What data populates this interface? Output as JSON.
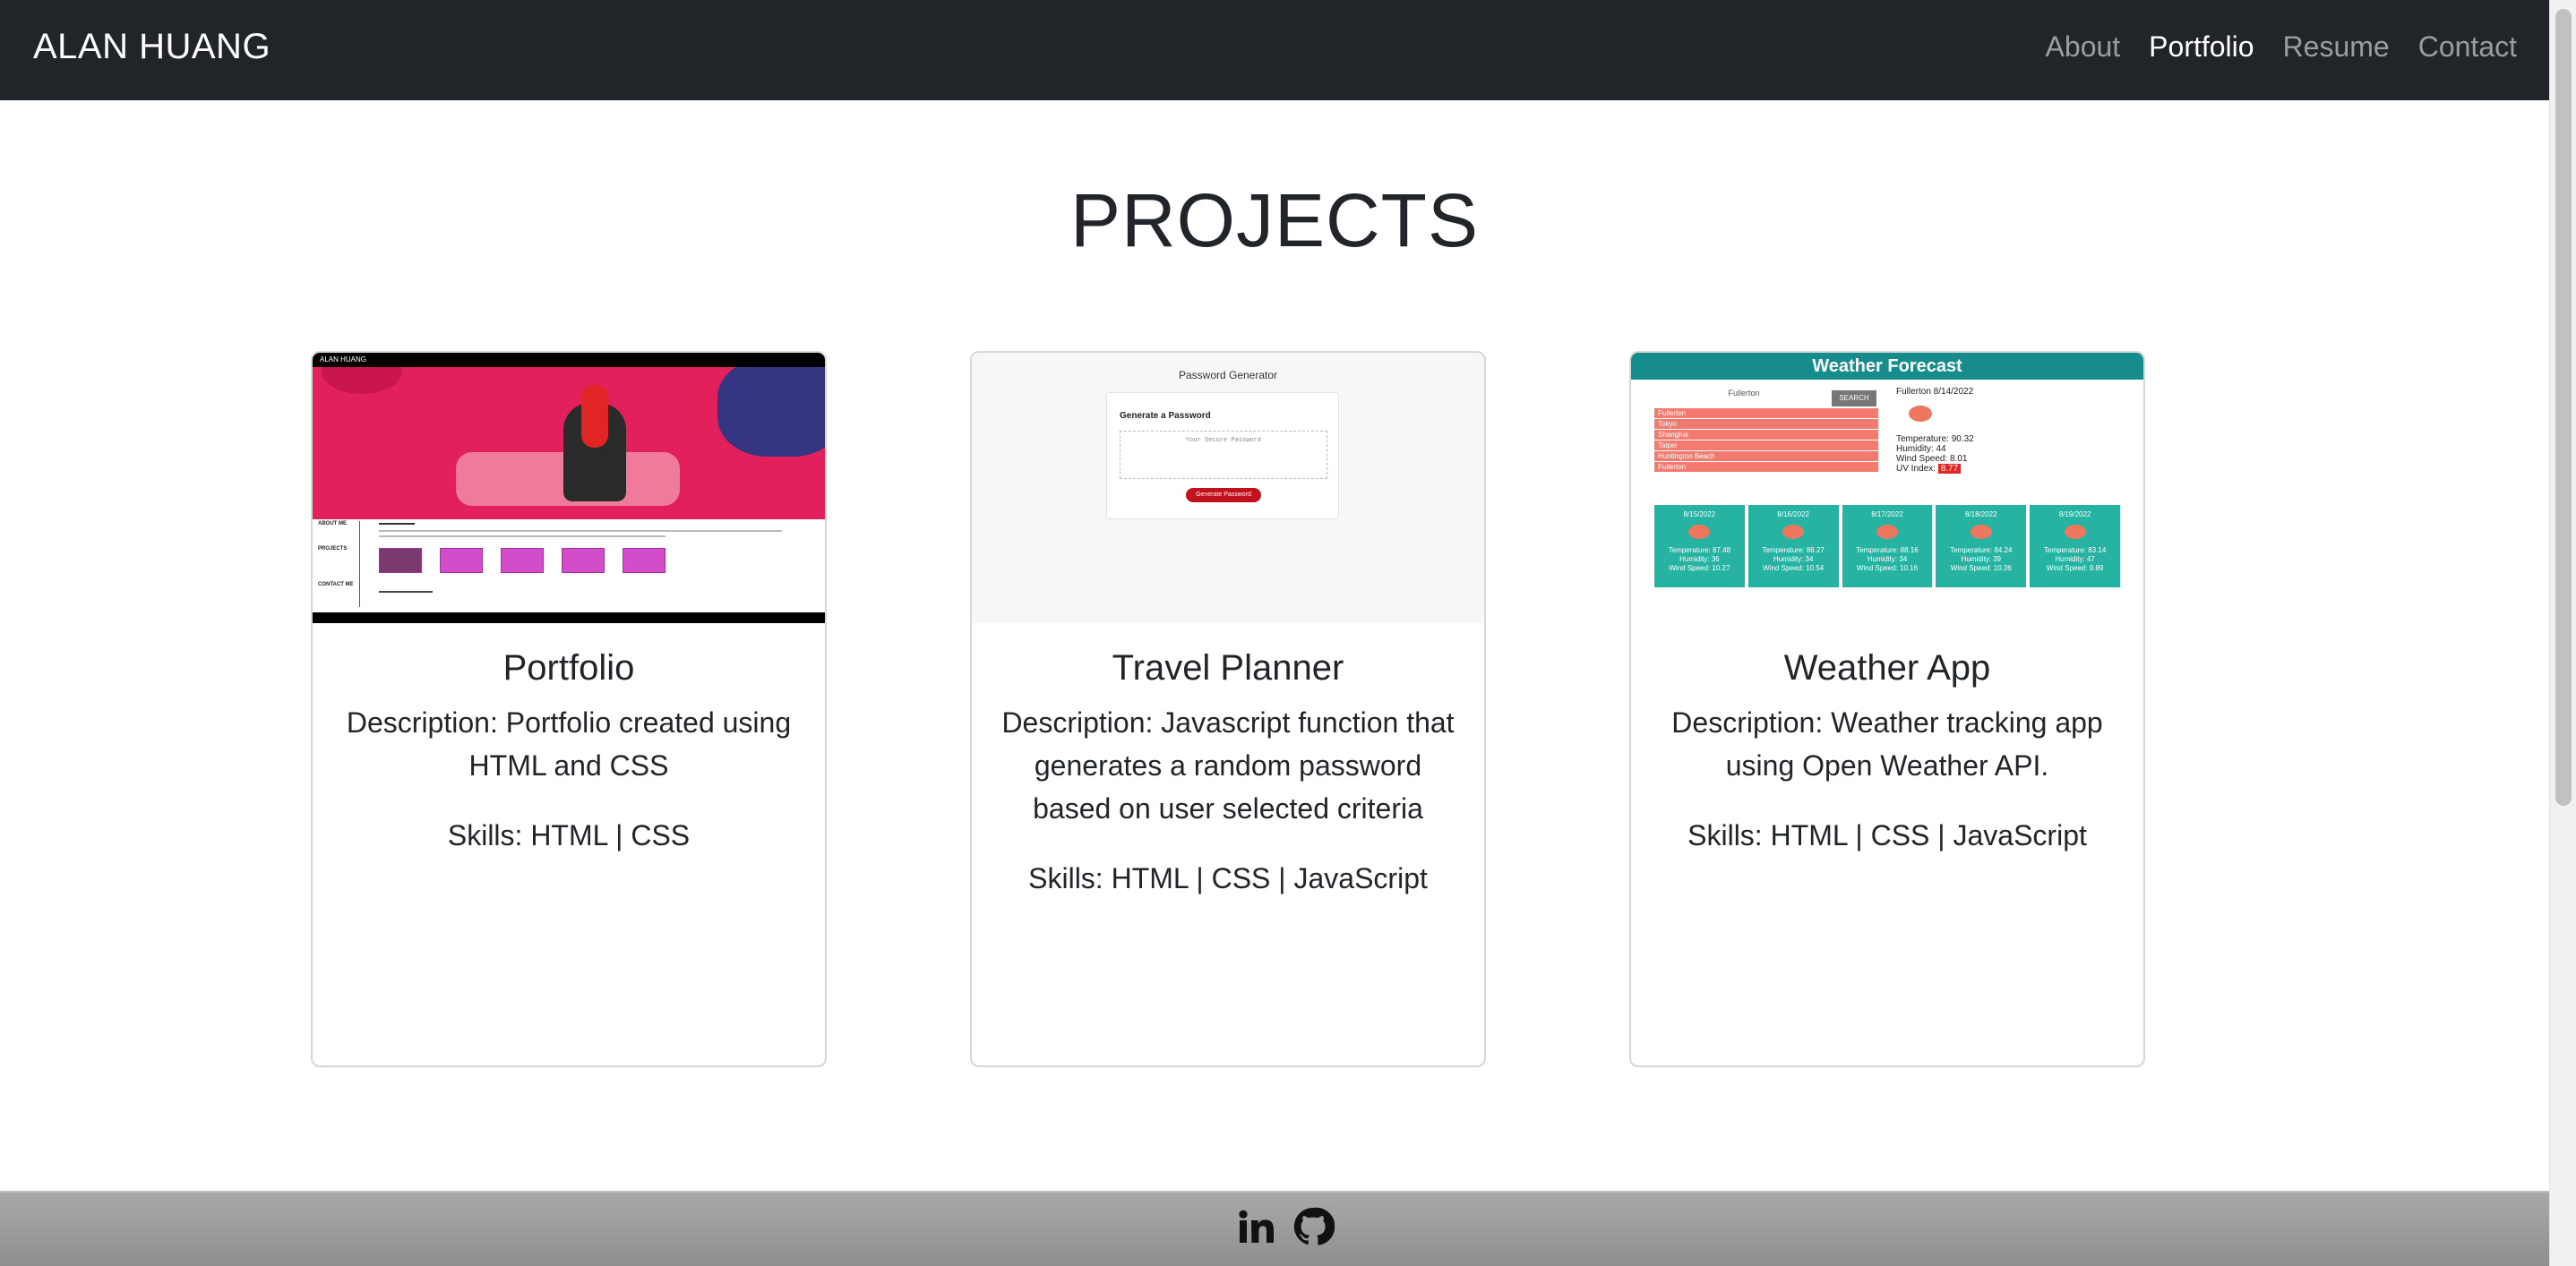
{
  "navbar": {
    "brand": "ALAN HUANG",
    "links": [
      {
        "label": "About",
        "active": false
      },
      {
        "label": "Portfolio",
        "active": true
      },
      {
        "label": "Resume",
        "active": false
      },
      {
        "label": "Contact",
        "active": false
      }
    ]
  },
  "section": {
    "title": "PROJECTS"
  },
  "projects": [
    {
      "title": "Portfolio",
      "description": "Description: Portfolio created using HTML and CSS",
      "skills": "Skills: HTML | CSS",
      "thumb": {
        "brand": "ALAN HUANG",
        "labels": [
          "ABOUT ME",
          "PROJECTS",
          "CONTACT ME"
        ]
      }
    },
    {
      "title": "Travel Planner",
      "description": "Description: Javascript function that generates a random password based on user selected criteria",
      "skills": "Skills: HTML | CSS | JavaScript",
      "thumb": {
        "title": "Password Generator",
        "card_heading": "Generate a Password",
        "placeholder": "Your Secure Password",
        "button": "Generate Password"
      }
    },
    {
      "title": "Weather App",
      "description": "Description: Weather tracking app using Open Weather API.",
      "skills": "Skills: HTML | CSS | JavaScript",
      "thumb": {
        "header": "Weather Forecast",
        "input": "Fullerton",
        "search": "SEARCH",
        "cities": [
          "Fullerton",
          "Tokyo",
          "Shanghai",
          "Taipei",
          "Huntington Beach",
          "Fullerton"
        ],
        "current": {
          "city_date": "Fullerton 8/14/2022",
          "temperature": "Temperature: 90.32",
          "humidity": "Humidity: 44",
          "wind": "Wind Speed: 8.01",
          "uv_label": "UV Index:",
          "uv_value": "8.77"
        },
        "days": [
          {
            "date": "8/15/2022",
            "temp": "Temperature: 87.48",
            "hum": "Humidity: 36",
            "wind": "Wind Speed: 10.27"
          },
          {
            "date": "8/16/2022",
            "temp": "Temperature: 88.27",
            "hum": "Humidity: 34",
            "wind": "Wind Speed: 10.54"
          },
          {
            "date": "8/17/2022",
            "temp": "Temperature: 88.16",
            "hum": "Humidity: 34",
            "wind": "Wind Speed: 10.16"
          },
          {
            "date": "8/18/2022",
            "temp": "Temperature: 84.24",
            "hum": "Humidity: 39",
            "wind": "Wind Speed: 10.36"
          },
          {
            "date": "8/19/2022",
            "temp": "Temperature: 83.14",
            "hum": "Humidity: 47",
            "wind": "Wind Speed: 9.89"
          }
        ]
      }
    }
  ],
  "footer": {
    "icons": [
      "linkedin-icon",
      "github-icon"
    ]
  }
}
